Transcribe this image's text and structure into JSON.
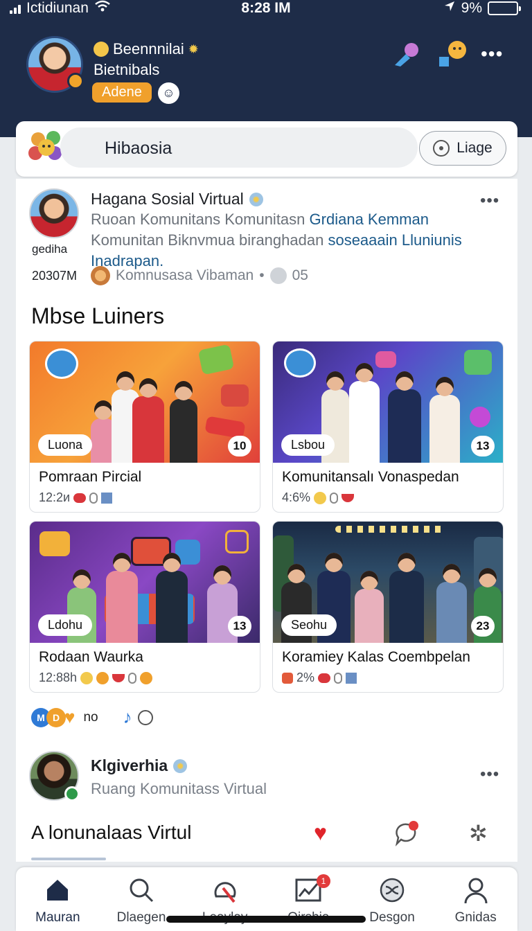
{
  "status_bar": {
    "carrier": "Ictidiunan",
    "time": "8:28 IM",
    "battery": "9%",
    "battery_level": 0.25
  },
  "profile": {
    "name": "Beennnilai",
    "subtitle": "Bietnibals",
    "badge": "Adene"
  },
  "search": {
    "placeholder": "Hibaosia",
    "button_label": "Liage"
  },
  "posts": [
    {
      "author": "Hagana Sosial Virtual",
      "handle": "gediha",
      "count": "20307M",
      "body_plain_1": "Ruoan Komunitans Komunitasn ",
      "body_highlight_1": "Grdiana Kemman",
      "body_plain_2": "Komunitan Biknvmua biranghadan ",
      "body_highlight_2": "soseaaain Lluniunis Inadrapan.",
      "meta_author": "Komnusasa Vibaman",
      "meta_sep": "•",
      "meta_count": "05"
    },
    {
      "author": "Klgiverhia",
      "subtitle": "Ruang Komunitass Virtual"
    }
  ],
  "section": {
    "title": "Mbse Luiners"
  },
  "cards": [
    {
      "label": "Luona",
      "number": "10",
      "title": "Pomraan Pircial",
      "meta": "12:2и"
    },
    {
      "label": "Lsbou",
      "number": "13",
      "title": "Komunitansalı Vonaspedan",
      "meta": "4:6%"
    },
    {
      "label": "Ldohu",
      "number": "13",
      "title": "Rodaan Waurka",
      "meta": "12:88h"
    },
    {
      "label": "Seohu",
      "number": "23",
      "title": "Koramiey Kalas Coembpelan",
      "meta": "2%"
    }
  ],
  "reactions": {
    "text": "no"
  },
  "feed_footer": {
    "title": "A lonunalaas Virtul"
  },
  "tabs": [
    {
      "label": "Mauran",
      "icon": "home-icon",
      "active": true
    },
    {
      "label": "Dlaegen",
      "icon": "search-icon"
    },
    {
      "label": "Leaylay",
      "icon": "create-icon"
    },
    {
      "label": "Oirshia",
      "icon": "chart-icon",
      "badge": "1"
    },
    {
      "label": "Desgon",
      "icon": "shuffle-icon"
    },
    {
      "label": "Gnidas",
      "icon": "profile-icon"
    }
  ],
  "colors": {
    "header_bg": "#1e2c48",
    "badge_orange": "#f0a02c",
    "link_blue": "#1c5a8a",
    "notification_red": "#e23b3b"
  }
}
